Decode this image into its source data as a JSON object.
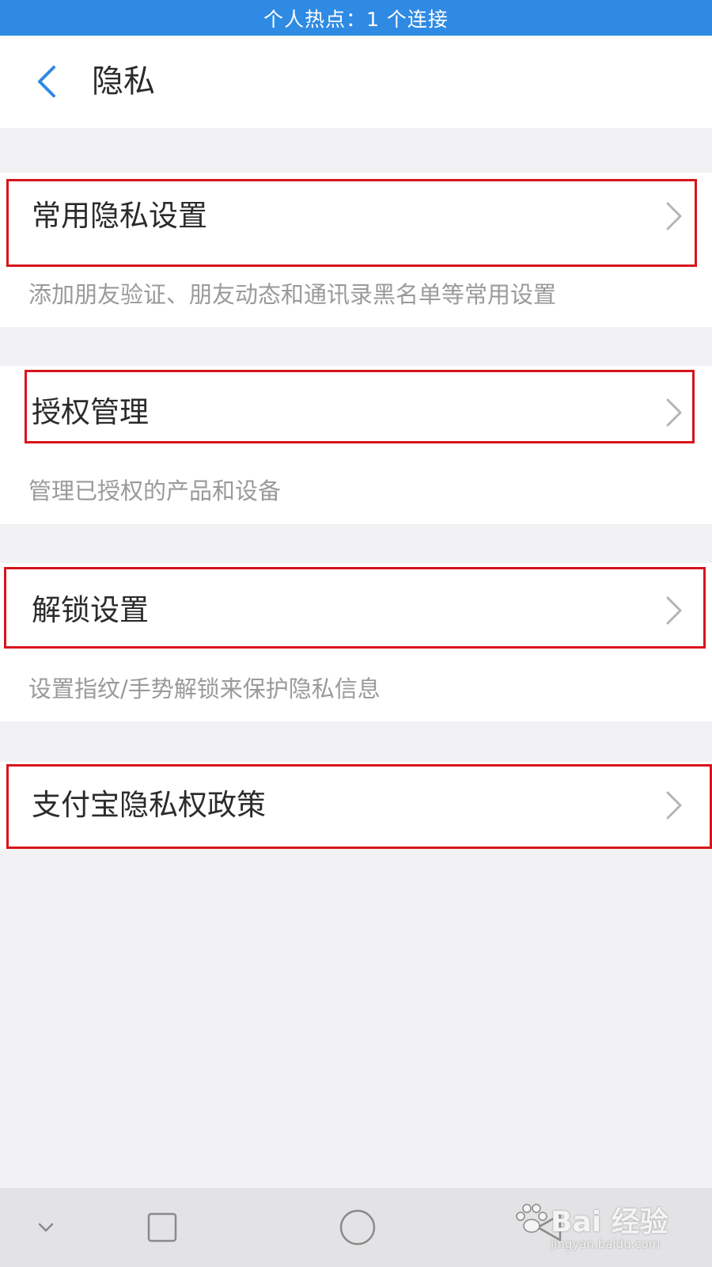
{
  "status_bar": {
    "text": "个人热点：1 个连接"
  },
  "header": {
    "title": "隐私",
    "back_icon": "chevron-left-icon"
  },
  "sections": [
    {
      "label": "常用隐私设置",
      "description": "添加朋友验证、朋友动态和通讯录黑名单等常用设置"
    },
    {
      "label": "授权管理",
      "description": "管理已授权的产品和设备"
    },
    {
      "label": "解锁设置",
      "description": "设置指纹/手势解锁来保护隐私信息"
    },
    {
      "label": "支付宝隐私权政策"
    }
  ],
  "system_nav": {
    "keys": [
      "collapse-icon",
      "recent-apps-icon",
      "home-icon",
      "back-icon"
    ]
  },
  "watermark": {
    "main": "Bai 经验",
    "sub": "jingyan.baidu.com"
  },
  "colors": {
    "status_bar": "#2f8ae3",
    "accent": "#2f8ae3",
    "highlight_border": "#d8141c",
    "description_text": "#9a9a9a",
    "page_background": "#f2f1f3"
  }
}
